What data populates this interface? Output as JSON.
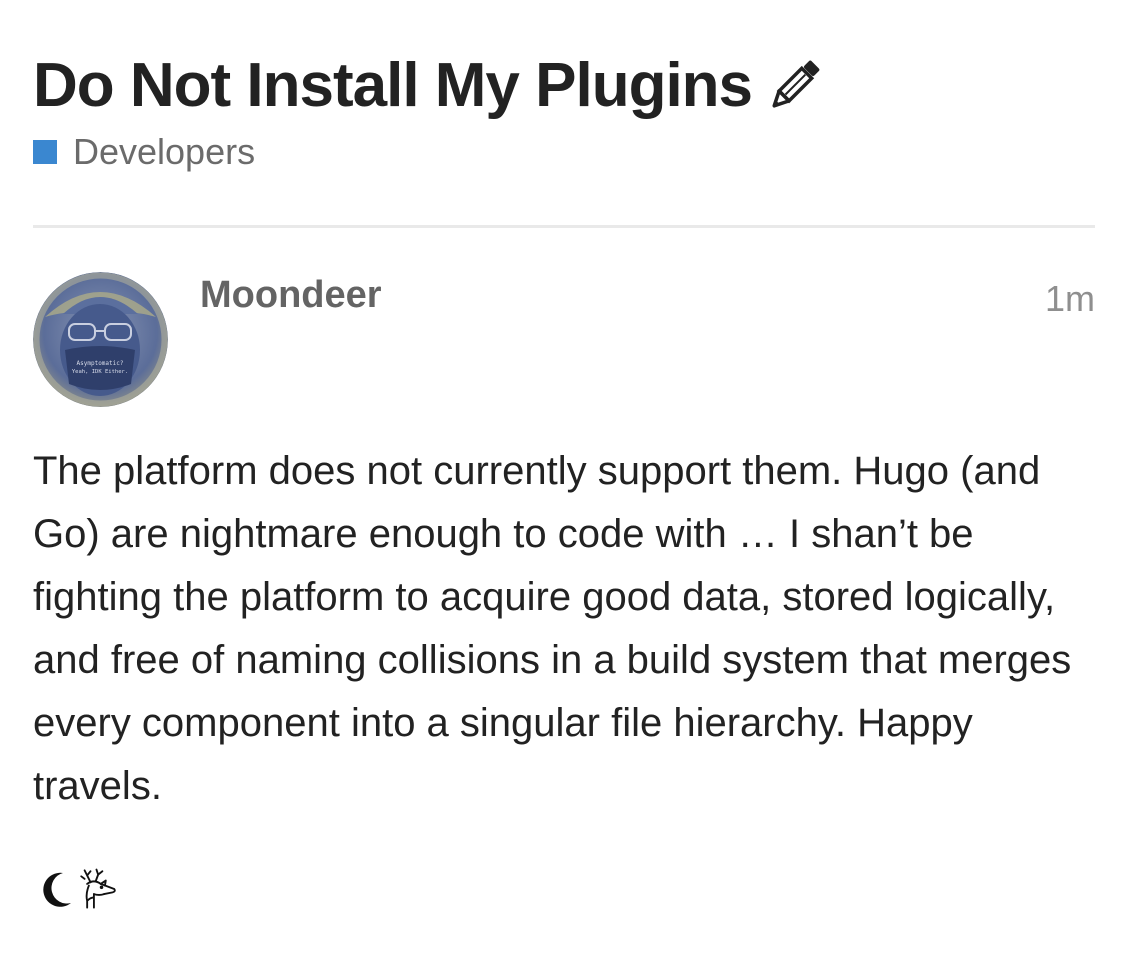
{
  "topic": {
    "title": "Do Not Install My Plugins",
    "edit_icon": "pencil-icon",
    "category": {
      "name": "Developers",
      "color": "#3a87d0"
    }
  },
  "post": {
    "author": "Moondeer",
    "time": "1m",
    "avatar_text": [
      "Asymptomatic?",
      "Yeah, IDK Either."
    ],
    "body": "The platform does not currently support them. Hugo (and Go) are nightmare enough to code with … I shan’t be fighting the platform to acquire good data, stored logically, and free of naming collisions in a build system that merges every component into a singular file hierarchy. Happy travels.",
    "signature_icons": [
      "crescent-moon-icon",
      "deer-icon"
    ]
  },
  "colors": {
    "title_text": "#222222",
    "muted_text": "#646464",
    "timestamp": "#8f8f8f",
    "divider": "#e9e9e9"
  }
}
